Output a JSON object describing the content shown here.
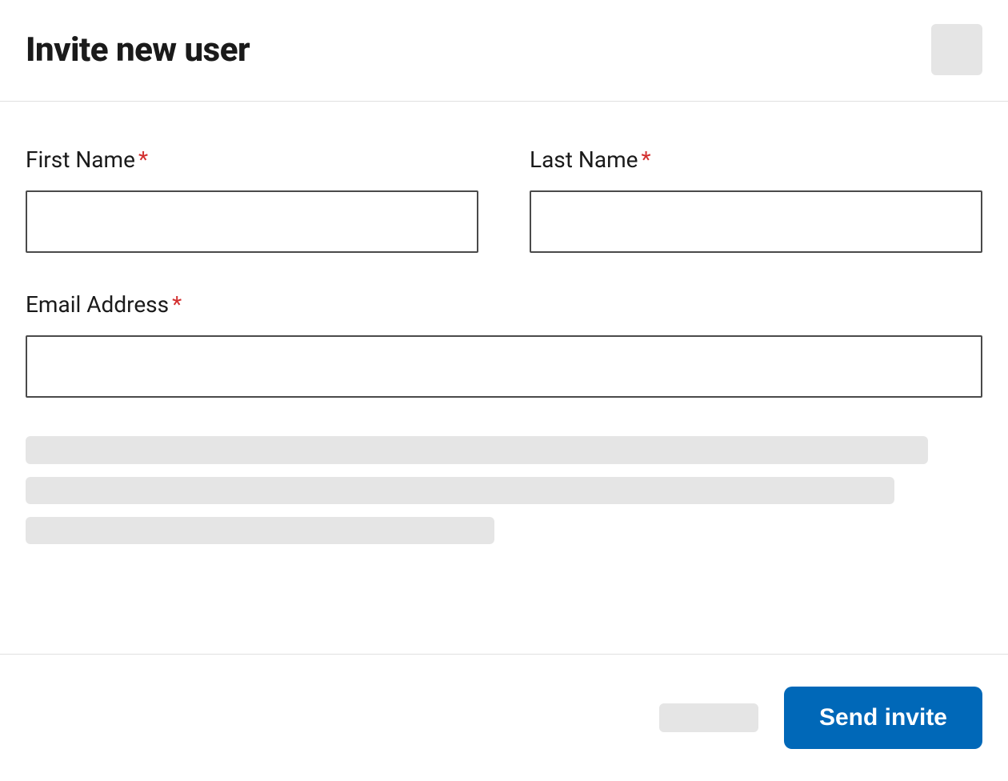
{
  "modal": {
    "title": "Invite new user"
  },
  "form": {
    "first_name": {
      "label": "First Name",
      "required_mark": "*",
      "value": ""
    },
    "last_name": {
      "label": "Last Name",
      "required_mark": "*",
      "value": ""
    },
    "email": {
      "label": "Email Address",
      "required_mark": "*",
      "value": ""
    }
  },
  "footer": {
    "send_label": "Send invite"
  }
}
